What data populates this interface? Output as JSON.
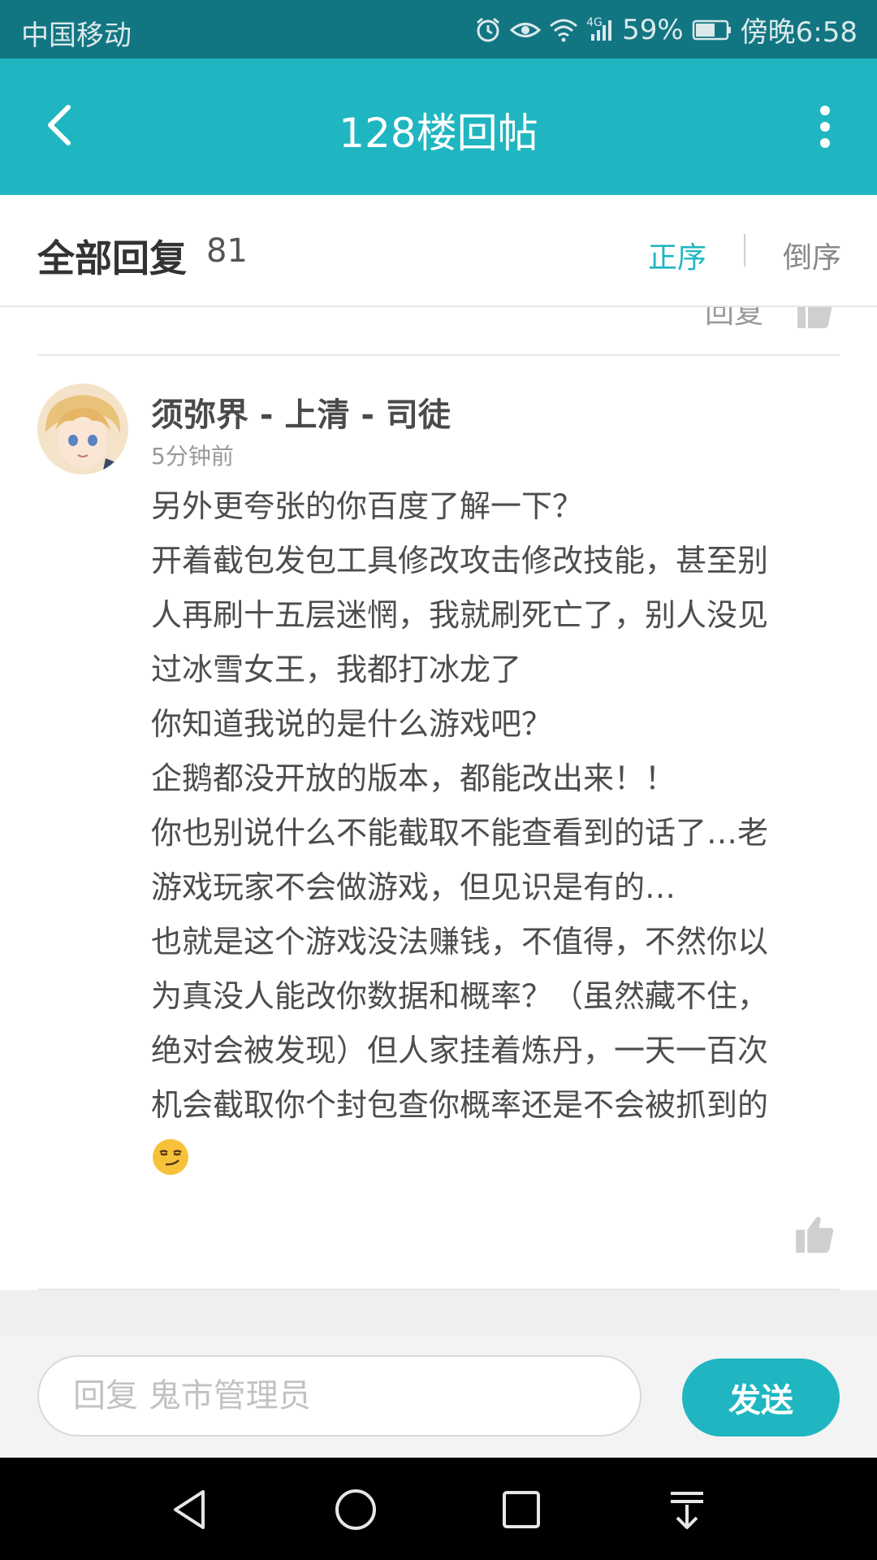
{
  "status_bar": {
    "carrier": "中国移动",
    "network": "4G",
    "battery": "59%",
    "time": "傍晚6:58"
  },
  "app_bar": {
    "title": "128楼回帖",
    "back_icon": "chevron-left-icon",
    "more_icon": "more-vertical-icon"
  },
  "sort_bar": {
    "all_label": "全部回复",
    "count": "81",
    "asc_label": "正序",
    "desc_label": "倒序",
    "active_color": "#1fb6c1"
  },
  "previous_reply": {
    "reply_label": "回复"
  },
  "post": {
    "author": "须弥界 - 上清 - 司徒",
    "time": "5分钟前",
    "lines": [
      "另外更夸张的你百度了解一下？",
      "开着截包发包工具修改攻击修改技能，甚至别",
      "人再刷十五层迷惘，我就刷死亡了，别人没见",
      "过冰雪女王，我都打冰龙了",
      "你知道我说的是什么游戏吧？",
      "企鹅都没开放的版本，都能改出来！！",
      "你也别说什么不能截取不能查看到的话了…老",
      "游戏玩家不会做游戏，但见识是有的…",
      "也就是这个游戏没法赚钱，不值得，不然你以",
      "为真没人能改你数据和概率？（虽然藏不住，",
      "绝对会被发现）但人家挂着炼丹，一天一百次",
      "机会截取你个封包查你概率还是不会被抓到的"
    ],
    "emoji": "smirk-emoji"
  },
  "composer": {
    "placeholder": "回复 鬼市管理员",
    "send_label": "发送"
  },
  "nav_bar": {
    "icons": [
      "back-triangle-icon",
      "home-circle-icon",
      "recents-square-icon",
      "pull-down-icon"
    ]
  },
  "colors": {
    "status_bar": "#127582",
    "app_bar": "#1fb6c1",
    "accent": "#1fb6c1"
  }
}
